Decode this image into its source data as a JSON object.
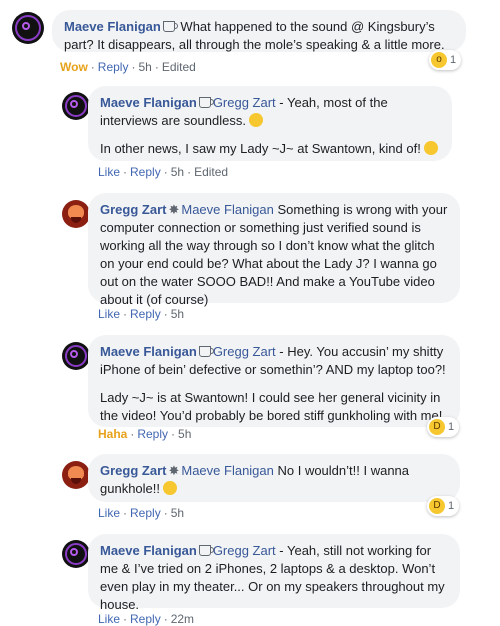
{
  "comments": [
    {
      "author": "Maeve Flanigan",
      "tag": "",
      "text": " What happened to the sound @ Kingsbury’s part? It disappears, all through the mole’s speaking & a little more.",
      "actions": {
        "reaction_label": "Wow",
        "reply": "Reply",
        "time": "5h",
        "edited": "Edited"
      },
      "reaction_count": "1"
    },
    {
      "author": "Maeve Flanigan",
      "tag": "Gregg Zart",
      "text": " - Yeah, most of the interviews are soundless.",
      "text2": "In other news, I saw my Lady ~J~ at Swantown, kind of!",
      "actions": {
        "like": "Like",
        "reply": "Reply",
        "time": "5h",
        "edited": "Edited"
      }
    },
    {
      "author": "Gregg Zart",
      "tag": "Maeve Flanigan",
      "text": " Something is wrong with your computer connection or something just verified sound is working all the way through so I don’t know what the glitch on your end could be? What about the Lady J? I wanna go out on the water SOOO BAD!! And make a YouTube video about it (of course)",
      "actions": {
        "like": "Like",
        "reply": "Reply",
        "time": "5h"
      }
    },
    {
      "author": "Maeve Flanigan",
      "tag": "Gregg Zart",
      "text": " - Hey. You accusin’ my shitty iPhone of bein’ defective or somethin’? AND my laptop too?!",
      "text2": "Lady ~J~ is at Swantown! I could see her general vicinity in the video! You’d probably be bored stiff gunkholing with me!",
      "actions": {
        "reaction_label": "Haha",
        "reply": "Reply",
        "time": "5h"
      },
      "reaction_count": "1"
    },
    {
      "author": "Gregg Zart",
      "tag": "Maeve Flanigan",
      "text": " No I wouldn’t!! I wanna gunkhole!!",
      "actions": {
        "like": "Like",
        "reply": "Reply",
        "time": "5h"
      },
      "reaction_count": "1"
    },
    {
      "author": "Maeve Flanigan",
      "tag": "Gregg Zart",
      "text": " - Yeah, still not working for me & I’ve tried on 2 iPhones, 2 laptops & a desktop. Won’t even play in my theater... Or on my speakers throughout my house.",
      "actions": {
        "like": "Like",
        "reply": "Reply",
        "time": "22m"
      }
    }
  ],
  "colors": {
    "author": "#385898",
    "link": "#4267b2",
    "wow": "#e7a21b",
    "bubble": "#f2f3f5"
  }
}
